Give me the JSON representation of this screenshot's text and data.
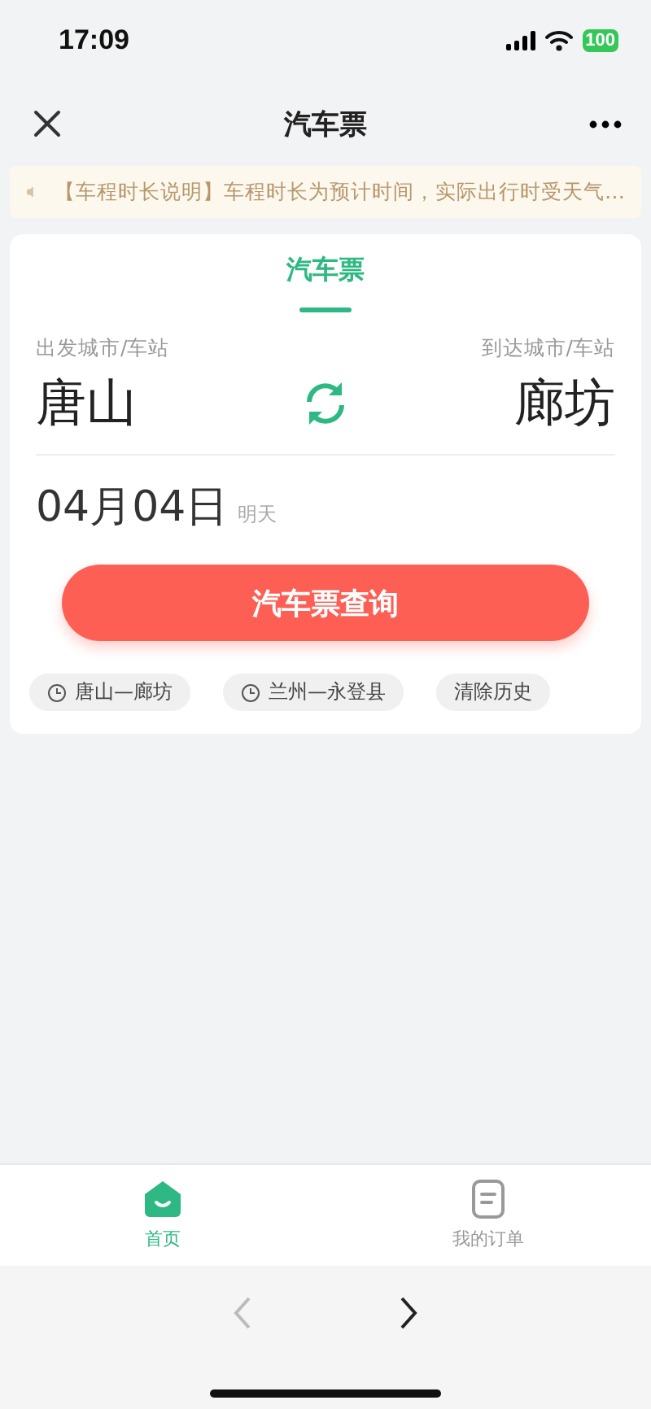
{
  "status_bar": {
    "time": "17:09",
    "battery": "100"
  },
  "nav": {
    "title": "汽车票"
  },
  "notice": {
    "text": "【车程时长说明】车程时长为预计时间，实际出行时受天气…"
  },
  "card": {
    "tabs": [
      {
        "label": "汽车票",
        "selected": true
      }
    ],
    "from": {
      "label": "出发城市/车站",
      "city": "唐山"
    },
    "to": {
      "label": "到达城市/车站",
      "city": "廊坊"
    },
    "date": {
      "value": "04月04日",
      "weekday": "明天"
    },
    "search_button": "汽车票查询",
    "history": [
      {
        "kind": "route",
        "label": "唐山—廊坊"
      },
      {
        "kind": "route",
        "label": "兰州—永登县"
      },
      {
        "kind": "clear",
        "label": "清除历史"
      }
    ]
  },
  "tab_bar": [
    {
      "label": "首页",
      "selected": true,
      "kind": "home"
    },
    {
      "label": "我的订单",
      "selected": false,
      "kind": "orders"
    }
  ],
  "browser": {
    "back_disabled": true,
    "forward_disabled": false
  }
}
